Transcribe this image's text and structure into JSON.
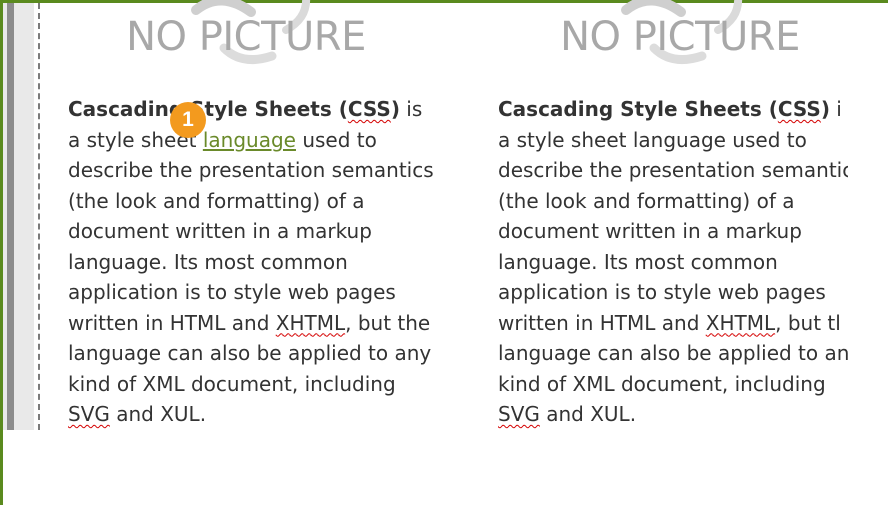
{
  "placeholder_image": {
    "label": "NO PICTURE"
  },
  "columns": [
    {
      "lines": [
        {
          "segments": [
            {
              "text": "Cascading Style Sheets (",
              "style": "bold"
            },
            {
              "text": "CSS",
              "style": "bold-squiggle"
            },
            {
              "text": ")",
              "style": "bold"
            },
            {
              "text": " is",
              "style": "normal"
            }
          ]
        },
        {
          "segments": [
            {
              "text": "a style sheet ",
              "style": "normal"
            },
            {
              "text": "language",
              "style": "link"
            },
            {
              "text": " used to",
              "style": "normal"
            }
          ]
        },
        {
          "segments": [
            {
              "text": "describe the presentation semantics",
              "style": "normal"
            }
          ]
        },
        {
          "segments": [
            {
              "text": "(the look and formatting) of a",
              "style": "normal"
            }
          ]
        },
        {
          "segments": [
            {
              "text": "document written in a markup",
              "style": "normal"
            }
          ]
        },
        {
          "segments": [
            {
              "text": "language. Its most common",
              "style": "normal"
            }
          ]
        },
        {
          "segments": [
            {
              "text": "application is to style web pages",
              "style": "normal"
            }
          ]
        },
        {
          "segments": [
            {
              "text": "written in HTML and ",
              "style": "normal"
            },
            {
              "text": "XHTML",
              "style": "squiggle"
            },
            {
              "text": ", but the",
              "style": "normal"
            }
          ]
        },
        {
          "segments": [
            {
              "text": "language can also be applied to any",
              "style": "normal"
            }
          ]
        },
        {
          "segments": [
            {
              "text": "kind of XML document, including",
              "style": "normal"
            }
          ]
        },
        {
          "segments": [
            {
              "text": "SVG",
              "style": "squiggle"
            },
            {
              "text": " and XUL.",
              "style": "normal"
            }
          ]
        }
      ]
    },
    {
      "lines": [
        {
          "segments": [
            {
              "text": "Cascading Style Sheets (",
              "style": "bold"
            },
            {
              "text": "CSS",
              "style": "bold-squiggle"
            },
            {
              "text": ")",
              "style": "bold"
            },
            {
              "text": " i",
              "style": "normal"
            }
          ]
        },
        {
          "segments": [
            {
              "text": "a style sheet language used to",
              "style": "normal"
            }
          ]
        },
        {
          "segments": [
            {
              "text": "describe the presentation semantic",
              "style": "normal"
            }
          ]
        },
        {
          "segments": [
            {
              "text": "(the look and formatting) of a",
              "style": "normal"
            }
          ]
        },
        {
          "segments": [
            {
              "text": "document written in a markup",
              "style": "normal"
            }
          ]
        },
        {
          "segments": [
            {
              "text": "language. Its most common",
              "style": "normal"
            }
          ]
        },
        {
          "segments": [
            {
              "text": "application is to style web pages",
              "style": "normal"
            }
          ]
        },
        {
          "segments": [
            {
              "text": "written in HTML and ",
              "style": "normal"
            },
            {
              "text": "XHTML",
              "style": "squiggle"
            },
            {
              "text": ", but tl",
              "style": "normal"
            }
          ]
        },
        {
          "segments": [
            {
              "text": "language can also be applied to an",
              "style": "normal"
            }
          ]
        },
        {
          "segments": [
            {
              "text": "kind of XML document, including",
              "style": "normal"
            }
          ]
        },
        {
          "segments": [
            {
              "text": "SVG",
              "style": "squiggle"
            },
            {
              "text": " and XUL.",
              "style": "normal"
            }
          ]
        }
      ]
    }
  ],
  "marker_badge": {
    "number": "1",
    "color": "#f39a1e"
  },
  "colors": {
    "frame": "#5a8a1e",
    "link": "#6a8a2a",
    "spell_error": "#d40000",
    "placeholder_text": "#a8a8a8"
  }
}
